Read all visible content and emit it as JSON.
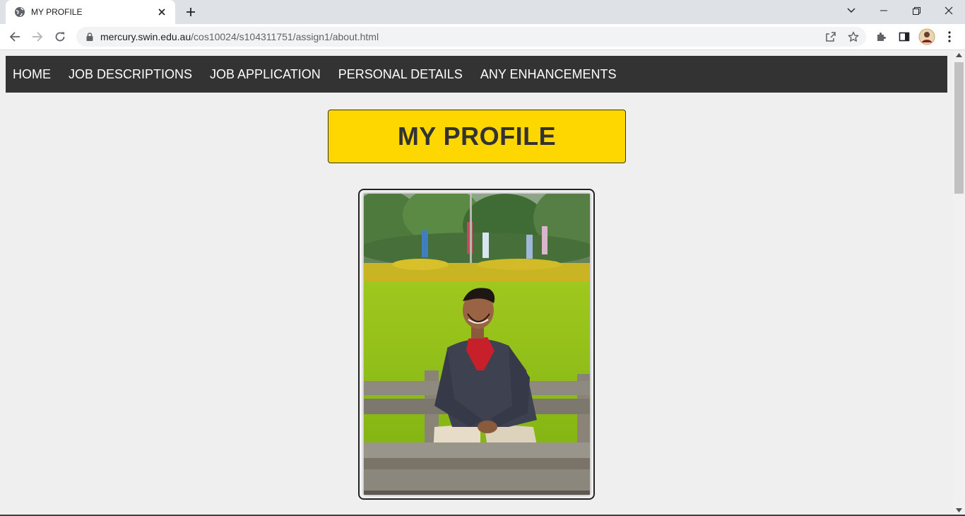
{
  "browser": {
    "tab_title": "MY PROFILE",
    "url_host": "mercury.swin.edu.au",
    "url_path": "/cos10024/s104311751/assign1/about.html"
  },
  "nav": {
    "items": [
      {
        "label": "HOME"
      },
      {
        "label": "JOB DESCRIPTIONS"
      },
      {
        "label": "JOB APPLICATION"
      },
      {
        "label": "PERSONAL DETAILS"
      },
      {
        "label": "ANY ENHANCEMENTS"
      }
    ]
  },
  "page": {
    "title": "MY PROFILE"
  },
  "colors": {
    "nav_bg": "#333333",
    "title_bg": "#ffd700",
    "page_bg": "#efefef"
  },
  "icons": {
    "tab_favicon": "globe-icon",
    "tab_close": "close-icon",
    "new_tab": "plus-icon",
    "back": "arrow-left-icon",
    "forward": "arrow-right-icon",
    "reload": "reload-icon",
    "lock": "lock-icon",
    "share": "share-icon",
    "bookmark": "star-icon",
    "extensions": "puzzle-icon",
    "side_panel": "side-panel-icon",
    "profile": "avatar",
    "menu": "kebab-menu-icon"
  }
}
